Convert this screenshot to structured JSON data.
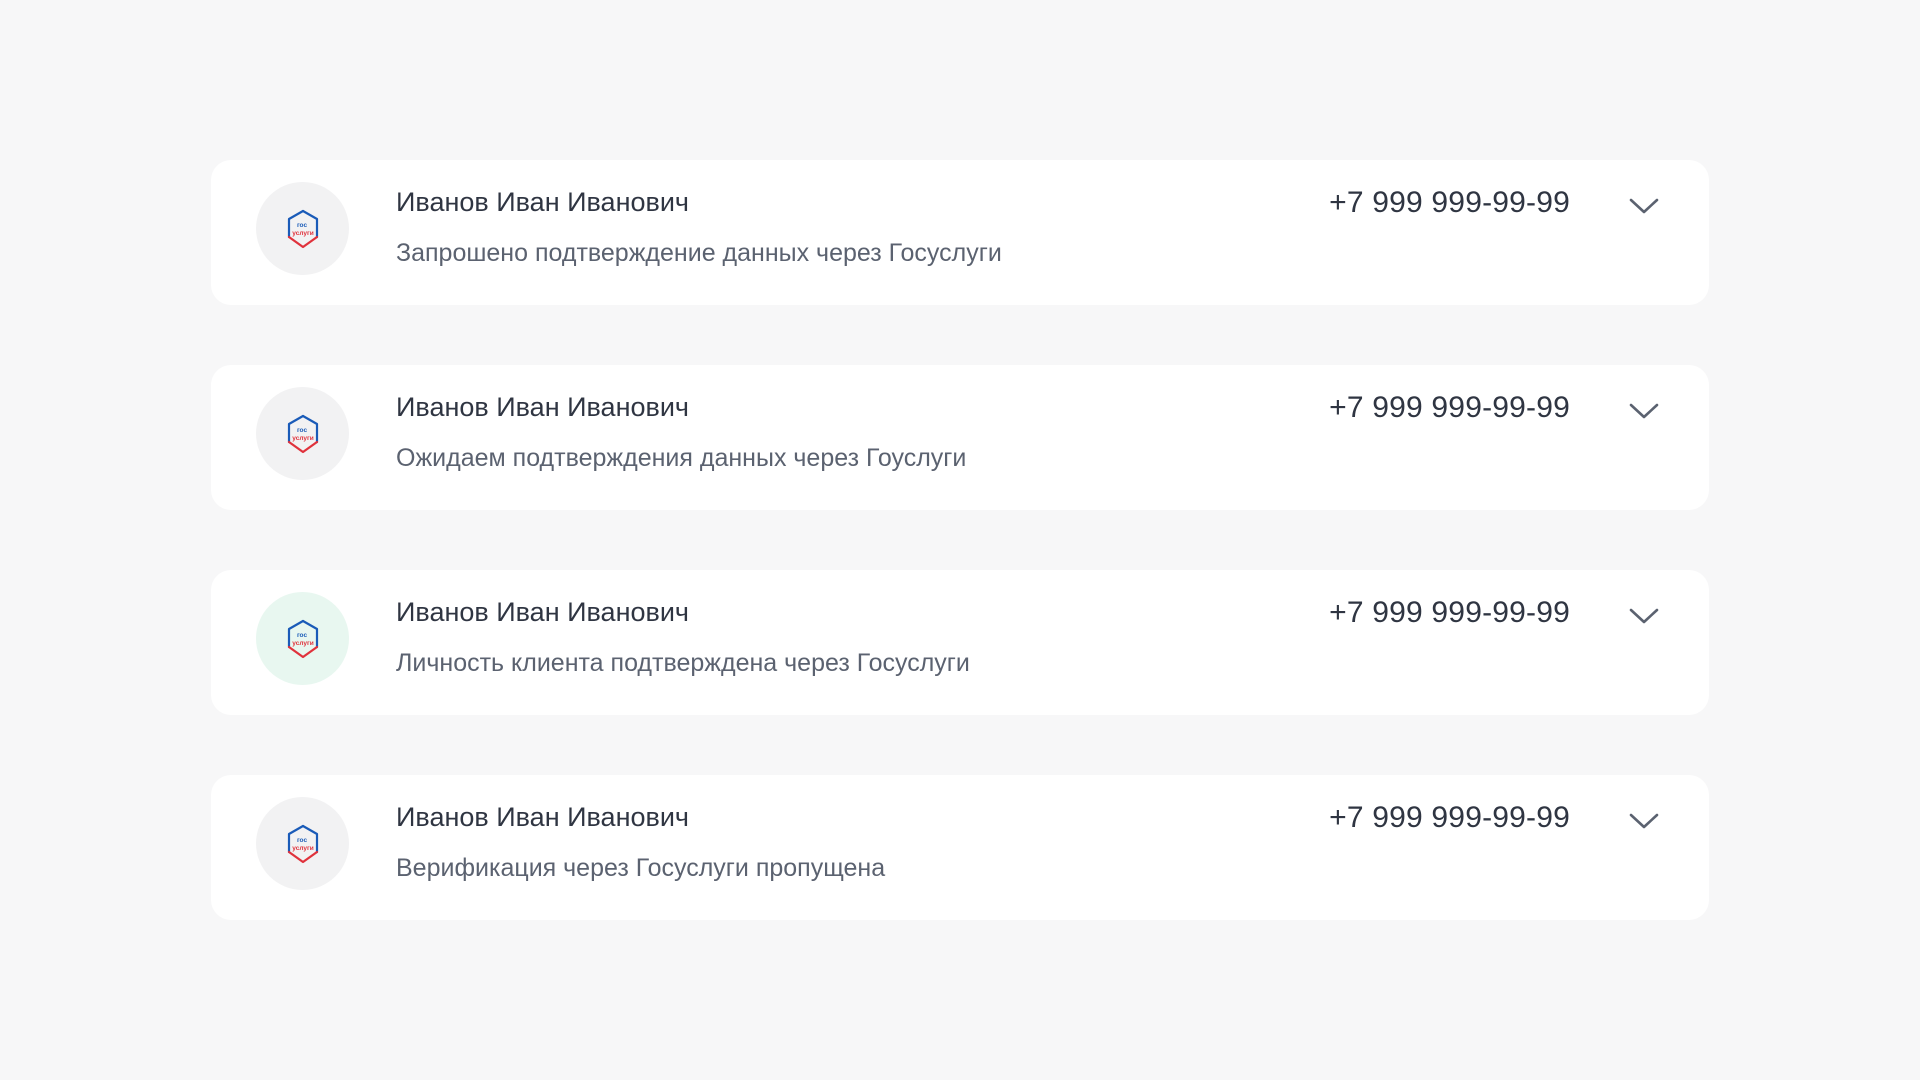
{
  "cards": [
    {
      "name": "Иванов Иван Иванович",
      "phone": "+7 999 999-99-99",
      "status": "Запрошено подтверждение данных через Госуслуги",
      "logo_text_top": "гос",
      "logo_text_bottom": "услуги",
      "icon": "gosuslugi-logo-icon",
      "verified": false
    },
    {
      "name": "Иванов Иван Иванович",
      "phone": "+7 999 999-99-99",
      "status": "Ожидаем подтверждения данных через Гоуслуги",
      "logo_text_top": "гос",
      "logo_text_bottom": "услуги",
      "icon": "gosuslugi-logo-icon",
      "verified": false
    },
    {
      "name": "Иванов Иван Иванович",
      "phone": "+7 999 999-99-99",
      "status": "Личность клиента подтверждена через Госуслуги",
      "logo_text_top": "гос",
      "logo_text_bottom": "услуги",
      "icon": "gosuslugi-logo-icon",
      "verified": true
    },
    {
      "name": "Иванов Иван Иванович",
      "phone": "+7 999 999-99-99",
      "status": "Верификация через Госуслуги пропущена",
      "logo_text_top": "гос",
      "logo_text_bottom": "услуги",
      "icon": "gosuslugi-logo-icon",
      "verified": false
    }
  ],
  "colors": {
    "page_background": "#f7f7f8",
    "card_background": "#ffffff",
    "avatar_neutral": "#f2f2f3",
    "avatar_verified": "#e8f7f0",
    "logo_blue": "#1a5bb8",
    "logo_red": "#e0323c",
    "text_primary": "#2f3542",
    "text_secondary": "#5b6270",
    "chevron": "#5b6270"
  }
}
